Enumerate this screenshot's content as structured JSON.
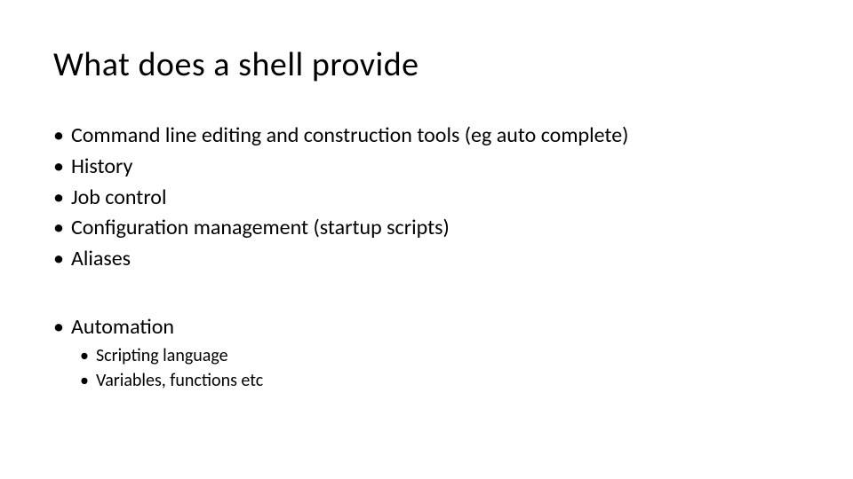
{
  "slide": {
    "title": "What does a shell provide",
    "group1": [
      "Command line editing and construction tools (eg auto complete)",
      "History",
      "Job control",
      "Configuration management (startup scripts)",
      "Aliases"
    ],
    "group2": {
      "label": "Automation",
      "subitems": [
        "Scripting language",
        "Variables, functions etc"
      ]
    }
  }
}
